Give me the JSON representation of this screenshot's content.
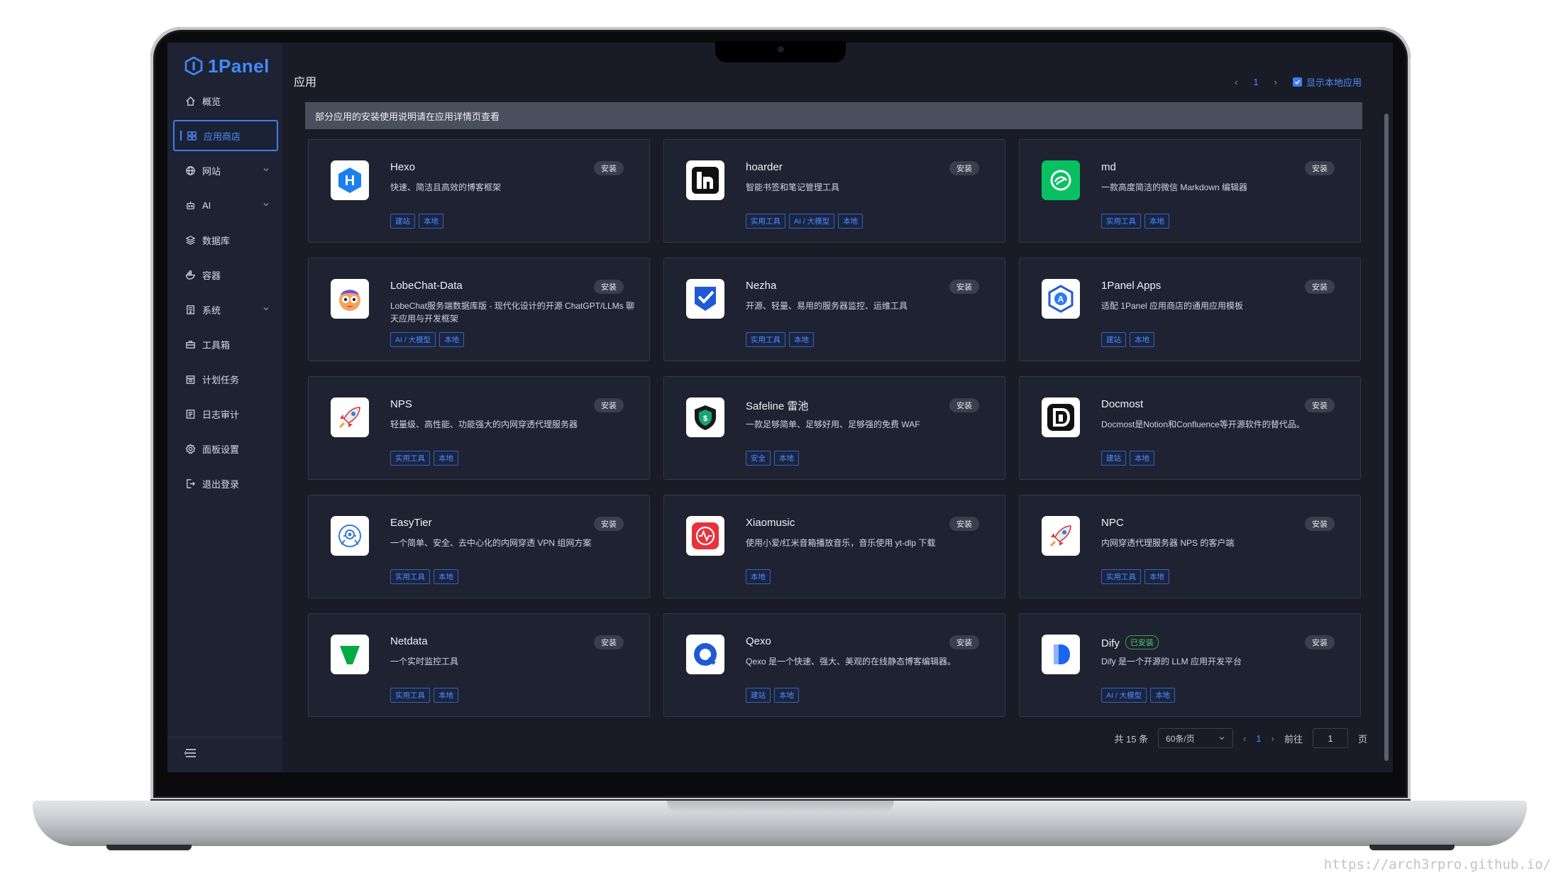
{
  "brand": {
    "name": "1Panel",
    "color": "#3f8cff"
  },
  "sidebar": {
    "items": [
      {
        "label": "概览",
        "icon": "home-icon"
      },
      {
        "label": "应用商店",
        "icon": "grid-icon",
        "active": true
      },
      {
        "label": "网站",
        "icon": "globe-icon",
        "expandable": true
      },
      {
        "label": "AI",
        "icon": "robot-icon",
        "expandable": true
      },
      {
        "label": "数据库",
        "icon": "database-icon"
      },
      {
        "label": "容器",
        "icon": "docker-icon"
      },
      {
        "label": "系统",
        "icon": "server-icon",
        "expandable": true
      },
      {
        "label": "工具箱",
        "icon": "toolbox-icon"
      },
      {
        "label": "计划任务",
        "icon": "calendar-icon"
      },
      {
        "label": "日志审计",
        "icon": "log-icon"
      },
      {
        "label": "面板设置",
        "icon": "settings-icon"
      },
      {
        "label": "退出登录",
        "icon": "logout-icon"
      }
    ]
  },
  "header": {
    "title": "应用",
    "page": "1",
    "show_local_label": "显示本地应用"
  },
  "notice": "部分应用的安装使用说明请在应用详情页查看",
  "install_label": "安装",
  "installed_label": "已安装",
  "apps": [
    {
      "name": "Hexo",
      "desc": "快速、简洁且高效的博客框架",
      "tags": [
        "建站",
        "本地"
      ],
      "icon": "hexo-icon"
    },
    {
      "name": "hoarder",
      "desc": "智能书签和笔记管理工具",
      "tags": [
        "实用工具",
        "AI / 大模型",
        "本地"
      ],
      "icon": "hoarder-icon"
    },
    {
      "name": "md",
      "desc": "一款高度简洁的微信 Markdown 编辑器",
      "tags": [
        "实用工具",
        "本地"
      ],
      "icon": "md-icon"
    },
    {
      "name": "LobeChat-Data",
      "desc": "LobeChat服务端数据库版 - 现代化设计的开源 ChatGPT/LLMs 聊天应用与开发框架",
      "tags": [
        "AI / 大模型",
        "本地"
      ],
      "icon": "lobechat-icon"
    },
    {
      "name": "Nezha",
      "desc": "开源、轻量、易用的服务器监控、运维工具",
      "tags": [
        "实用工具",
        "本地"
      ],
      "icon": "nezha-icon"
    },
    {
      "name": "1Panel Apps",
      "desc": "适配 1Panel 应用商店的通用应用模板",
      "tags": [
        "建站",
        "本地"
      ],
      "icon": "1panel-apps-icon"
    },
    {
      "name": "NPS",
      "desc": "轻量级、高性能、功能强大的内网穿透代理服务器",
      "tags": [
        "实用工具",
        "本地"
      ],
      "icon": "nps-rocket-icon"
    },
    {
      "name": "Safeline 雷池",
      "desc": "一款足够简单、足够好用、足够强的免费 WAF",
      "tags": [
        "安全",
        "本地"
      ],
      "icon": "safeline-shield-icon"
    },
    {
      "name": "Docmost",
      "desc": "Docmost是Notion和Confluence等开源软件的替代品。",
      "tags": [
        "建站",
        "本地"
      ],
      "icon": "docmost-icon"
    },
    {
      "name": "EasyTier",
      "desc": "一个简单、安全、去中心化的内网穿透 VPN 组网方案",
      "tags": [
        "实用工具",
        "本地"
      ],
      "icon": "easytier-icon"
    },
    {
      "name": "Xiaomusic",
      "desc": "使用小爱/红米音箱播放音乐，音乐使用 yt-dlp 下载",
      "tags": [
        "本地"
      ],
      "icon": "xiaomusic-icon"
    },
    {
      "name": "NPC",
      "desc": "内网穿透代理服务器 NPS 的客户端",
      "tags": [
        "实用工具",
        "本地"
      ],
      "icon": "npc-rocket-icon"
    },
    {
      "name": "Netdata",
      "desc": "一个实时监控工具",
      "tags": [
        "实用工具",
        "本地"
      ],
      "icon": "netdata-icon"
    },
    {
      "name": "Qexo",
      "desc": "Qexo 是一个快速、强大、美观的在线静态博客编辑器。",
      "tags": [
        "建站",
        "本地"
      ],
      "icon": "qexo-icon"
    },
    {
      "name": "Dify",
      "desc": "Dify 是一个开源的 LLM 应用开发平台",
      "tags": [
        "AI / 大模型",
        "本地"
      ],
      "icon": "dify-icon",
      "installed": true
    }
  ],
  "pagination": {
    "total": "共 15 条",
    "page_size": "60条/页",
    "current": "1",
    "goto_label": "前往",
    "goto_value": "1",
    "page_suffix": "页"
  },
  "watermark": "https://arch3rpro.github.io/",
  "colors": {
    "accent": "#3f7df0",
    "background": "#191b26",
    "card": "#1f2231",
    "installed": "#4ccd6e"
  }
}
